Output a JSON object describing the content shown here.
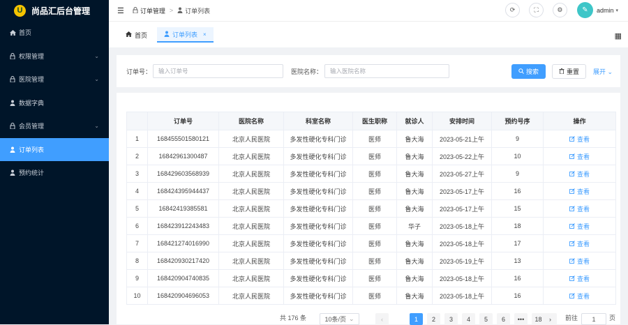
{
  "app": {
    "title": "尚品汇后台管理",
    "logo_letter": "U"
  },
  "sidebar": {
    "items": [
      {
        "label": "首页",
        "icon": "home-icon",
        "chevron": false,
        "active": false
      },
      {
        "label": "权限管理",
        "icon": "lock-icon",
        "chevron": true,
        "active": false
      },
      {
        "label": "医院管理",
        "icon": "lock-icon",
        "chevron": true,
        "active": false
      },
      {
        "label": "数据字典",
        "icon": "user-icon",
        "chevron": false,
        "active": false
      },
      {
        "label": "会员管理",
        "icon": "lock-icon",
        "chevron": true,
        "active": false
      },
      {
        "label": "订单列表",
        "icon": "user-icon",
        "chevron": false,
        "active": true
      },
      {
        "label": "预约统计",
        "icon": "user-icon",
        "chevron": false,
        "active": false
      }
    ]
  },
  "header": {
    "breadcrumb": [
      "订单管理",
      "订单列表"
    ],
    "username": "admin"
  },
  "tabs": [
    {
      "label": "首页",
      "active": false
    },
    {
      "label": "订单列表",
      "active": true
    }
  ],
  "search": {
    "order_label": "订单号：",
    "order_placeholder": "输入订单号",
    "hospital_label": "医院名称：",
    "hospital_placeholder": "输入医院名称",
    "search_button": "搜索",
    "reset_button": "重置",
    "expand_label": "展开"
  },
  "table": {
    "headers": [
      "",
      "订单号",
      "医院名称",
      "科室名称",
      "医生职称",
      "就诊人",
      "安排时间",
      "预约号序",
      "操作"
    ],
    "action_label": "查看",
    "rows": [
      [
        "1",
        "168455501580121",
        "北京人民医院",
        "多发性硬化专科门诊",
        "医师",
        "鲁大海",
        "2023-05-21上午",
        "9"
      ],
      [
        "2",
        "16842961300487",
        "北京人民医院",
        "多发性硬化专科门诊",
        "医师",
        "鲁大海",
        "2023-05-22上午",
        "10"
      ],
      [
        "3",
        "168429603568939",
        "北京人民医院",
        "多发性硬化专科门诊",
        "医师",
        "鲁大海",
        "2023-05-27上午",
        "9"
      ],
      [
        "4",
        "168424395944437",
        "北京人民医院",
        "多发性硬化专科门诊",
        "医师",
        "鲁大海",
        "2023-05-17上午",
        "16"
      ],
      [
        "5",
        "16842419385581",
        "北京人民医院",
        "多发性硬化专科门诊",
        "医师",
        "鲁大海",
        "2023-05-17上午",
        "15"
      ],
      [
        "6",
        "168423912243483",
        "北京人民医院",
        "多发性硬化专科门诊",
        "医师",
        "华子",
        "2023-05-18上午",
        "18"
      ],
      [
        "7",
        "168421274016990",
        "北京人民医院",
        "多发性硬化专科门诊",
        "医师",
        "鲁大海",
        "2023-05-18上午",
        "17"
      ],
      [
        "8",
        "168420930217420",
        "北京人民医院",
        "多发性硬化专科门诊",
        "医师",
        "鲁大海",
        "2023-05-19上午",
        "13"
      ],
      [
        "9",
        "168420904740835",
        "北京人民医院",
        "多发性硬化专科门诊",
        "医师",
        "鲁大海",
        "2023-05-18上午",
        "16"
      ],
      [
        "10",
        "168420904696053",
        "北京人民医院",
        "多发性硬化专科门诊",
        "医师",
        "鲁大海",
        "2023-05-18上午",
        "16"
      ]
    ]
  },
  "pagination": {
    "total": "共 176 条",
    "page_size": "10条/页",
    "pages": [
      "1",
      "2",
      "3",
      "4",
      "5",
      "6",
      "•••",
      "18"
    ],
    "current": "1",
    "goto_label": "前往",
    "goto_value": "1",
    "page_suffix": "页"
  },
  "colors": {
    "accent": "#409eff",
    "sidebar_bg": "#001529"
  }
}
